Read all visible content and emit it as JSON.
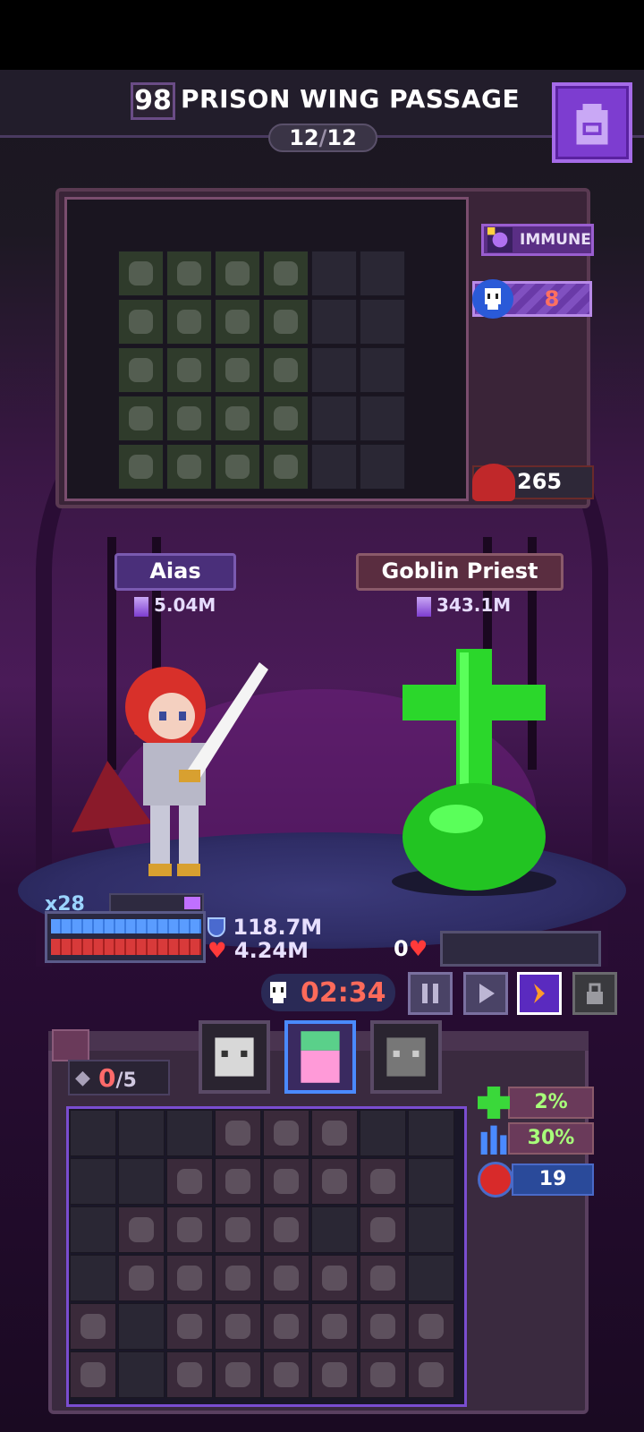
{
  "header": {
    "level": "98",
    "title": "PRISON WING PASSAGE",
    "wave_current": "12",
    "wave_sep": "/",
    "wave_total": "12",
    "bag_icon": "backpack-icon"
  },
  "enemy_panel": {
    "status_label": "IMMUNE",
    "skull_count": "8",
    "bomb_value": "265"
  },
  "hero": {
    "name": "Aias",
    "power": "5.04M",
    "multiplier": "x28",
    "shield": "118.7M",
    "health": "4.24M"
  },
  "enemy": {
    "name": "Goblin Priest",
    "power": "343.1M",
    "health": "0"
  },
  "battle": {
    "timer": "02:34"
  },
  "inventory": {
    "slots_used": "0",
    "slots_total": "/5",
    "buffs": {
      "heal": "2%",
      "speed": "30%",
      "rage": "19"
    }
  },
  "colors": {
    "accent_purple": "#7d3dd0",
    "timer_red": "#ff6a5a",
    "heal_green": "#a8ff7a"
  }
}
